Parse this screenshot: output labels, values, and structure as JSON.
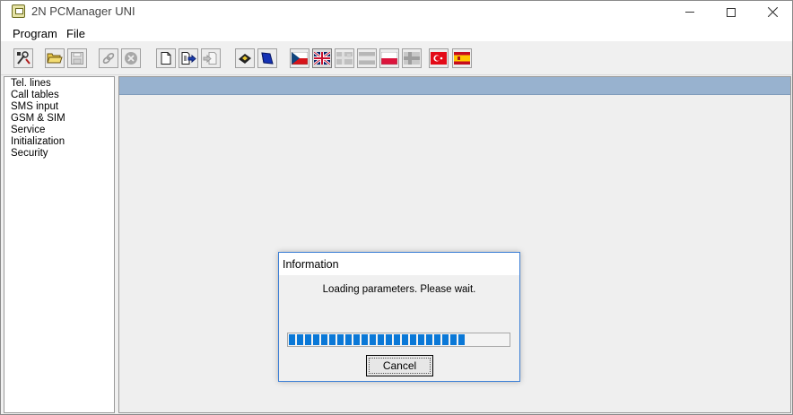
{
  "window": {
    "title": "2N PCManager UNI"
  },
  "menu": {
    "items": [
      "Program",
      "File"
    ]
  },
  "toolbar": {
    "buttons": [
      {
        "icon": "config-tools-icon",
        "state": "enabled"
      },
      {
        "icon": "open-folder-icon",
        "state": "enabled"
      },
      {
        "icon": "save-disk-icon",
        "state": "disabled"
      },
      {
        "icon": "connect-link-icon",
        "state": "disabled"
      },
      {
        "icon": "stop-circle-icon",
        "state": "disabled"
      },
      {
        "icon": "new-document-icon",
        "state": "enabled"
      },
      {
        "icon": "export-document-icon",
        "state": "enabled"
      },
      {
        "icon": "import-document-icon",
        "state": "disabled"
      },
      {
        "icon": "sim-card-icon",
        "state": "enabled"
      },
      {
        "icon": "blue-book-icon",
        "state": "enabled"
      },
      {
        "icon": "flag-czech-icon",
        "state": "enabled"
      },
      {
        "icon": "flag-uk-icon",
        "state": "selected"
      },
      {
        "icon": "flag-disabled-1-icon",
        "state": "disabled"
      },
      {
        "icon": "flag-disabled-2-icon",
        "state": "disabled"
      },
      {
        "icon": "flag-poland-icon",
        "state": "enabled"
      },
      {
        "icon": "flag-disabled-3-icon",
        "state": "disabled"
      },
      {
        "icon": "flag-turkey-icon",
        "state": "enabled"
      },
      {
        "icon": "flag-spain-icon",
        "state": "enabled"
      }
    ]
  },
  "tree": {
    "items": [
      "Tel. lines",
      "Call tables",
      "SMS input",
      "GSM & SIM",
      "Service",
      "Initialization",
      "Security"
    ]
  },
  "dialog": {
    "title": "Information",
    "message": "Loading parameters. Please wait.",
    "progress": 0.81,
    "cancel_label": "Cancel"
  },
  "colors": {
    "main_header": "#98b2cf",
    "progress_fill": "#0a78d7",
    "dialog_border": "#3c7fd6"
  }
}
